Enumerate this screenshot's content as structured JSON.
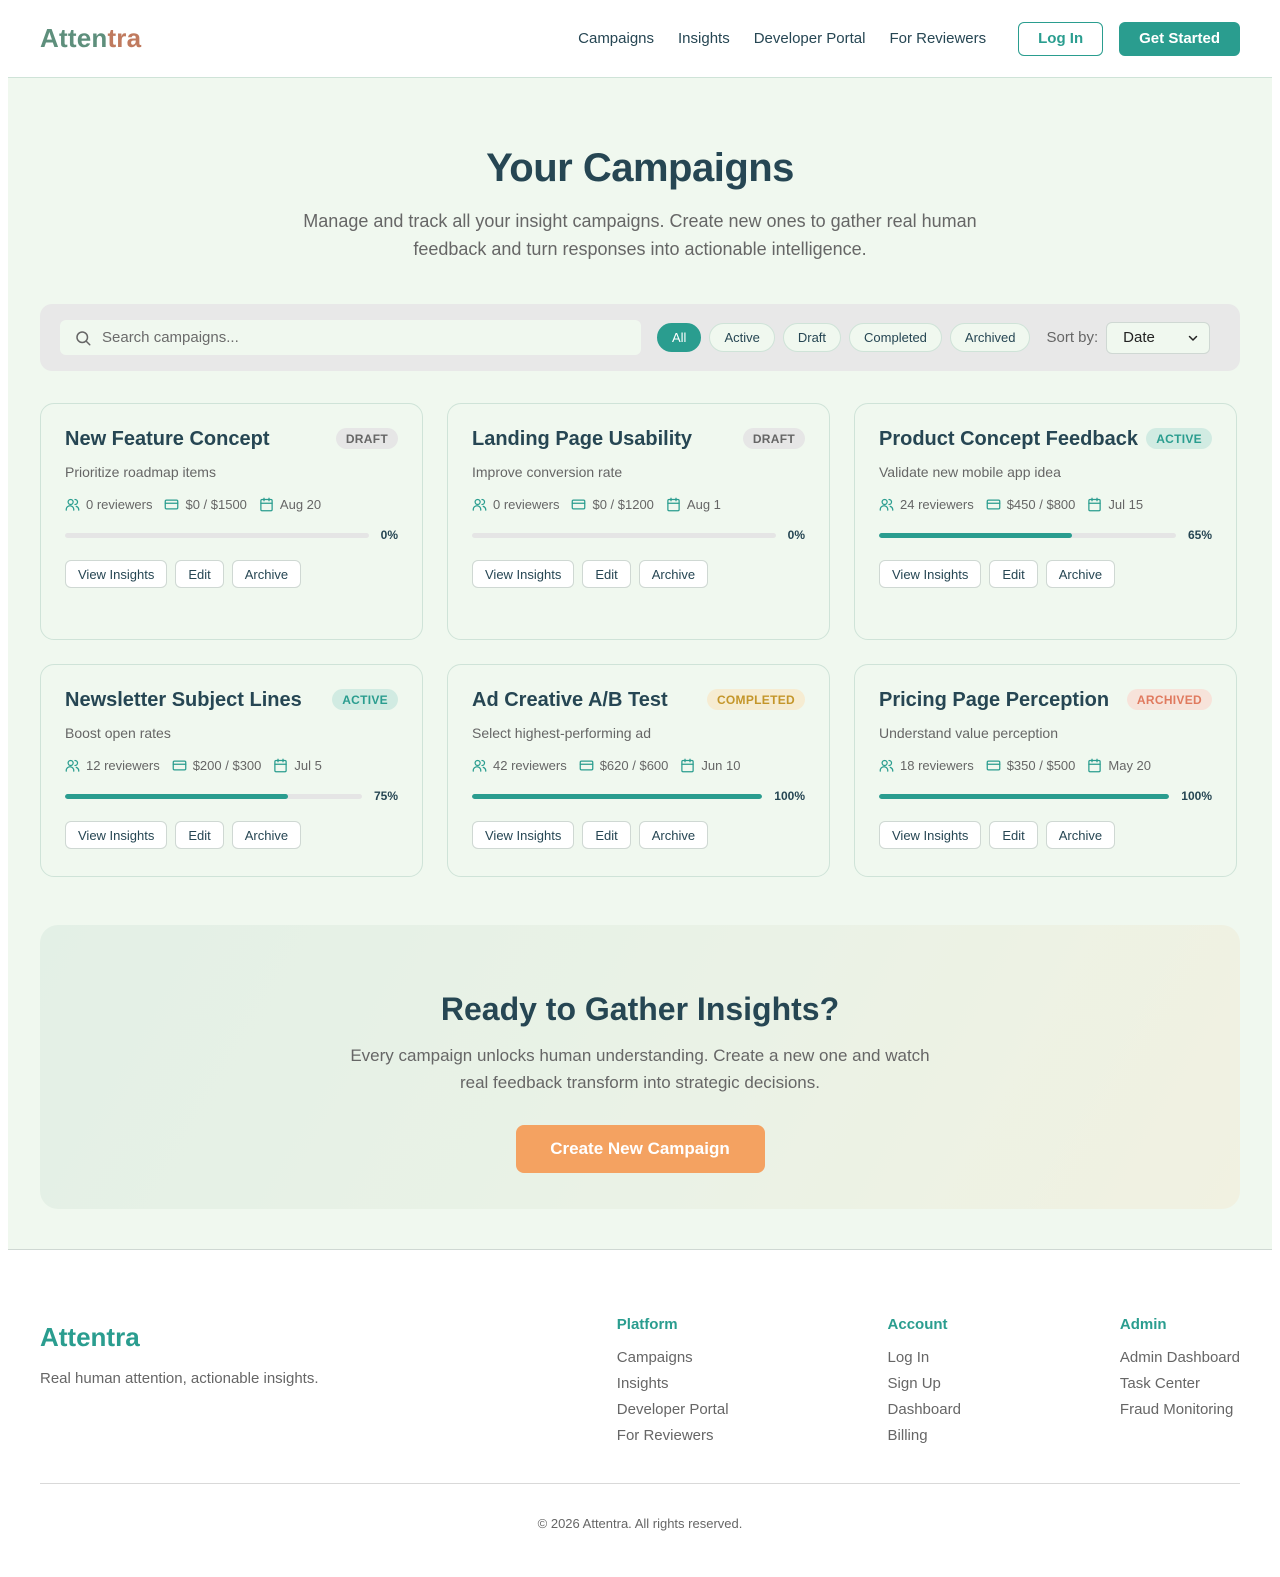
{
  "brand": {
    "part1": "Atten",
    "part2": "tra",
    "name": "Attentra"
  },
  "nav": {
    "links": [
      "Campaigns",
      "Insights",
      "Developer Portal",
      "For Reviewers"
    ],
    "login": "Log In",
    "get_started": "Get Started"
  },
  "hero": {
    "title": "Your Campaigns",
    "subtitle": "Manage and track all your insight campaigns. Create new ones to gather real human feedback and turn responses into actionable intelligence."
  },
  "filters": {
    "search_placeholder": "Search campaigns...",
    "chips": [
      "All",
      "Active",
      "Draft",
      "Completed",
      "Archived"
    ],
    "active_chip": "All",
    "sort_label": "Sort by:",
    "sort_value": "Date"
  },
  "cards": [
    {
      "title": "New Feature Concept",
      "status": "DRAFT",
      "status_kind": "draft",
      "desc": "Prioritize roadmap items",
      "reviewers": "0 reviewers",
      "budget": "$0 / $1500",
      "date": "Aug 20",
      "progress": 0,
      "progress_label": "0%"
    },
    {
      "title": "Landing Page Usability",
      "status": "DRAFT",
      "status_kind": "draft",
      "desc": "Improve conversion rate",
      "reviewers": "0 reviewers",
      "budget": "$0 / $1200",
      "date": "Aug 1",
      "progress": 0,
      "progress_label": "0%"
    },
    {
      "title": "Product Concept Feedback",
      "status": "ACTIVE",
      "status_kind": "active",
      "desc": "Validate new mobile app idea",
      "reviewers": "24 reviewers",
      "budget": "$450 / $800",
      "date": "Jul 15",
      "progress": 65,
      "progress_label": "65%"
    },
    {
      "title": "Newsletter Subject Lines",
      "status": "ACTIVE",
      "status_kind": "active",
      "desc": "Boost open rates",
      "reviewers": "12 reviewers",
      "budget": "$200 / $300",
      "date": "Jul 5",
      "progress": 75,
      "progress_label": "75%"
    },
    {
      "title": "Ad Creative A/B Test",
      "status": "COMPLETED",
      "status_kind": "completed",
      "desc": "Select highest-performing ad",
      "reviewers": "42 reviewers",
      "budget": "$620 / $600",
      "date": "Jun 10",
      "progress": 100,
      "progress_label": "100%"
    },
    {
      "title": "Pricing Page Perception",
      "status": "ARCHIVED",
      "status_kind": "archived",
      "desc": "Understand value perception",
      "reviewers": "18 reviewers",
      "budget": "$350 / $500",
      "date": "May 20",
      "progress": 100,
      "progress_label": "100%"
    }
  ],
  "card_actions": [
    "View Insights",
    "Edit",
    "Archive"
  ],
  "cta": {
    "title": "Ready to Gather Insights?",
    "text": "Every campaign unlocks human understanding. Create a new one and watch real feedback transform into strategic decisions.",
    "button": "Create New Campaign"
  },
  "footer": {
    "tagline": "Real human attention, actionable insights.",
    "columns": [
      {
        "title": "Platform",
        "links": [
          "Campaigns",
          "Insights",
          "Developer Portal",
          "For Reviewers"
        ]
      },
      {
        "title": "Account",
        "links": [
          "Log In",
          "Sign Up",
          "Dashboard",
          "Billing"
        ]
      },
      {
        "title": "Admin",
        "links": [
          "Admin Dashboard",
          "Task Center",
          "Fraud Monitoring"
        ]
      }
    ],
    "copyright": "© 2026 Attentra. All rights reserved."
  },
  "colors": {
    "primary": "#2a9d8f",
    "dark": "#264653",
    "accent": "#f4a261",
    "background": "#f0f8ef",
    "archived": "#e07a5f",
    "completed": "#c4962a"
  },
  "icons": {
    "search": "search-icon",
    "reviewers": "users-icon",
    "budget": "credit-card-icon",
    "date": "calendar-icon",
    "sort": "chevron-down-icon"
  }
}
